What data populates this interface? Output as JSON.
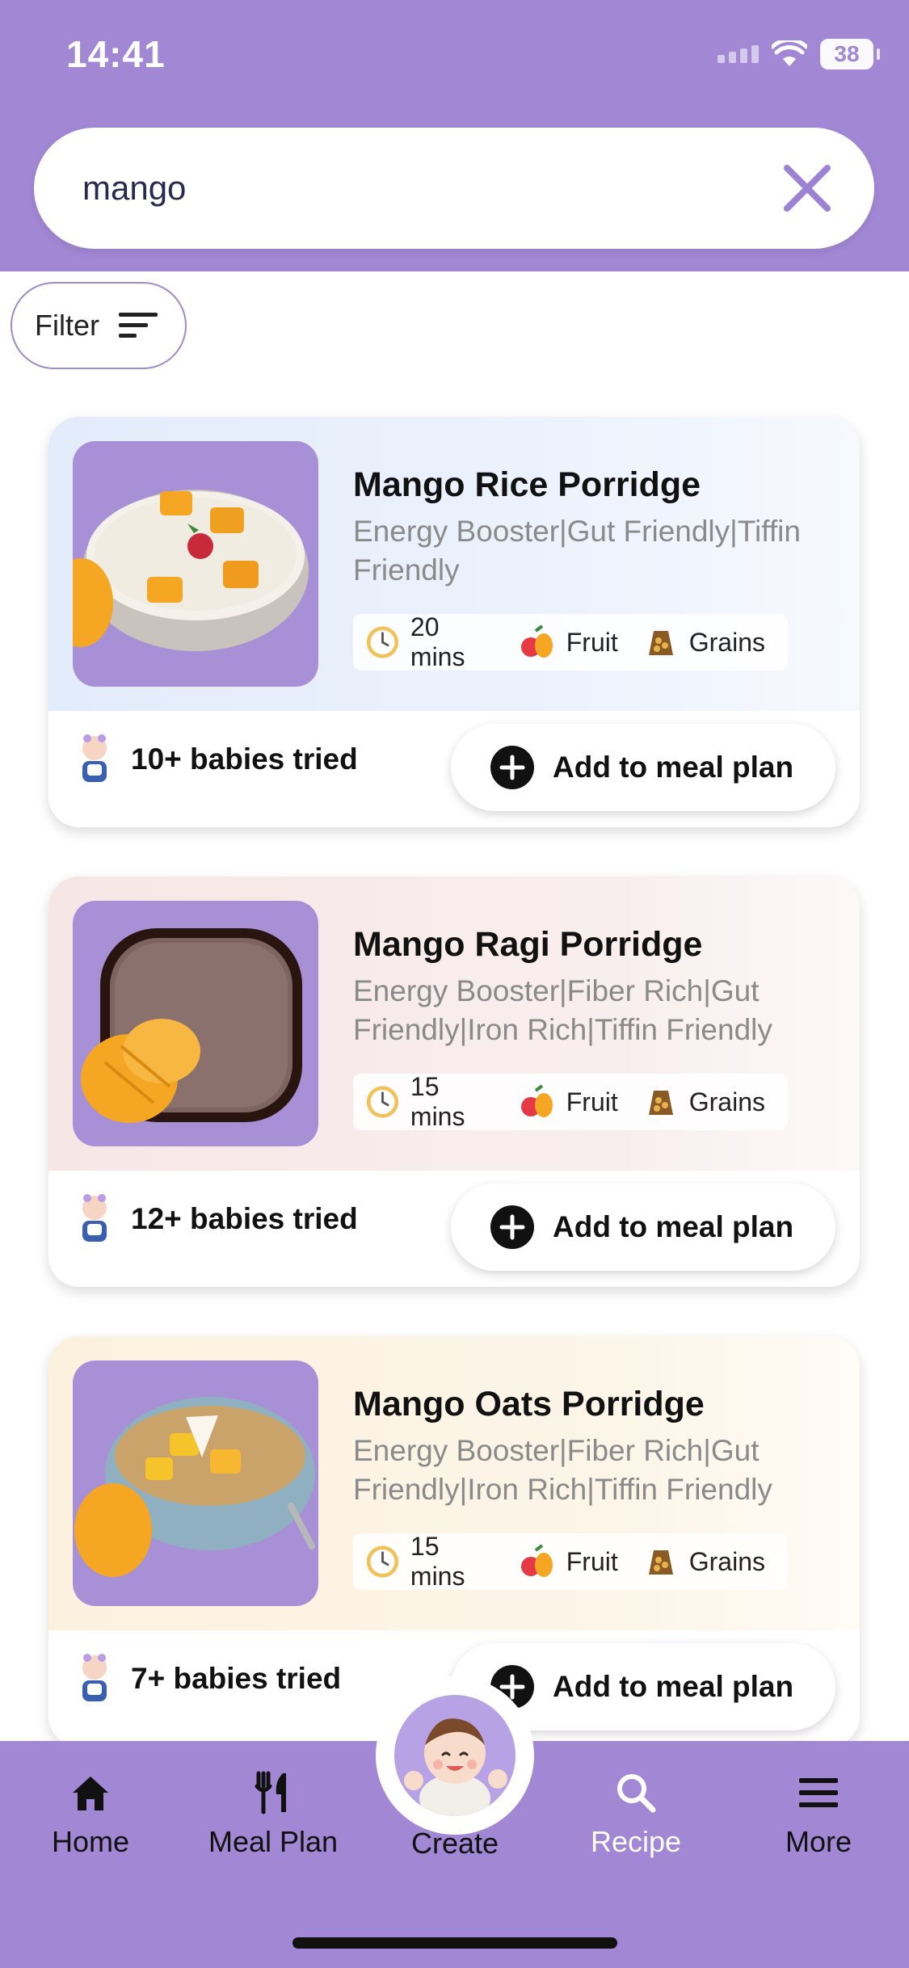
{
  "status_bar": {
    "time": "14:41",
    "battery": "38"
  },
  "search": {
    "value": "mango"
  },
  "filter": {
    "label": "Filter"
  },
  "recipes": [
    {
      "title": "Mango Rice Porridge",
      "tags": "Energy Booster|Gut Friendly|Tiffin Friendly",
      "time": "20 mins",
      "category1": "Fruit",
      "category2": "Grains",
      "babies": "10+ babies tried",
      "add_label": "Add to meal plan",
      "bg_color": "#e6eefb"
    },
    {
      "title": "Mango Ragi Porridge",
      "tags": "Energy Booster|Fiber Rich|Gut Friendly|Iron Rich|Tiffin Friendly",
      "time": "15 mins",
      "category1": "Fruit",
      "category2": "Grains",
      "babies": "12+ babies tried",
      "add_label": "Add to meal plan",
      "bg_color": "#f8eaea"
    },
    {
      "title": "Mango Oats Porridge",
      "tags": "Energy Booster|Fiber Rich|Gut Friendly|Iron Rich|Tiffin Friendly",
      "time": "15 mins",
      "category1": "Fruit",
      "category2": "Grains",
      "babies": "7+ babies tried",
      "add_label": "Add to meal plan",
      "bg_color": "#fcf4e3"
    }
  ],
  "nav": {
    "home": "Home",
    "meal_plan": "Meal Plan",
    "create": "Create",
    "recipe": "Recipe",
    "more": "More",
    "active": "recipe"
  },
  "colors": {
    "brand": "#a287d4",
    "card_border": "#9d8ac8"
  }
}
